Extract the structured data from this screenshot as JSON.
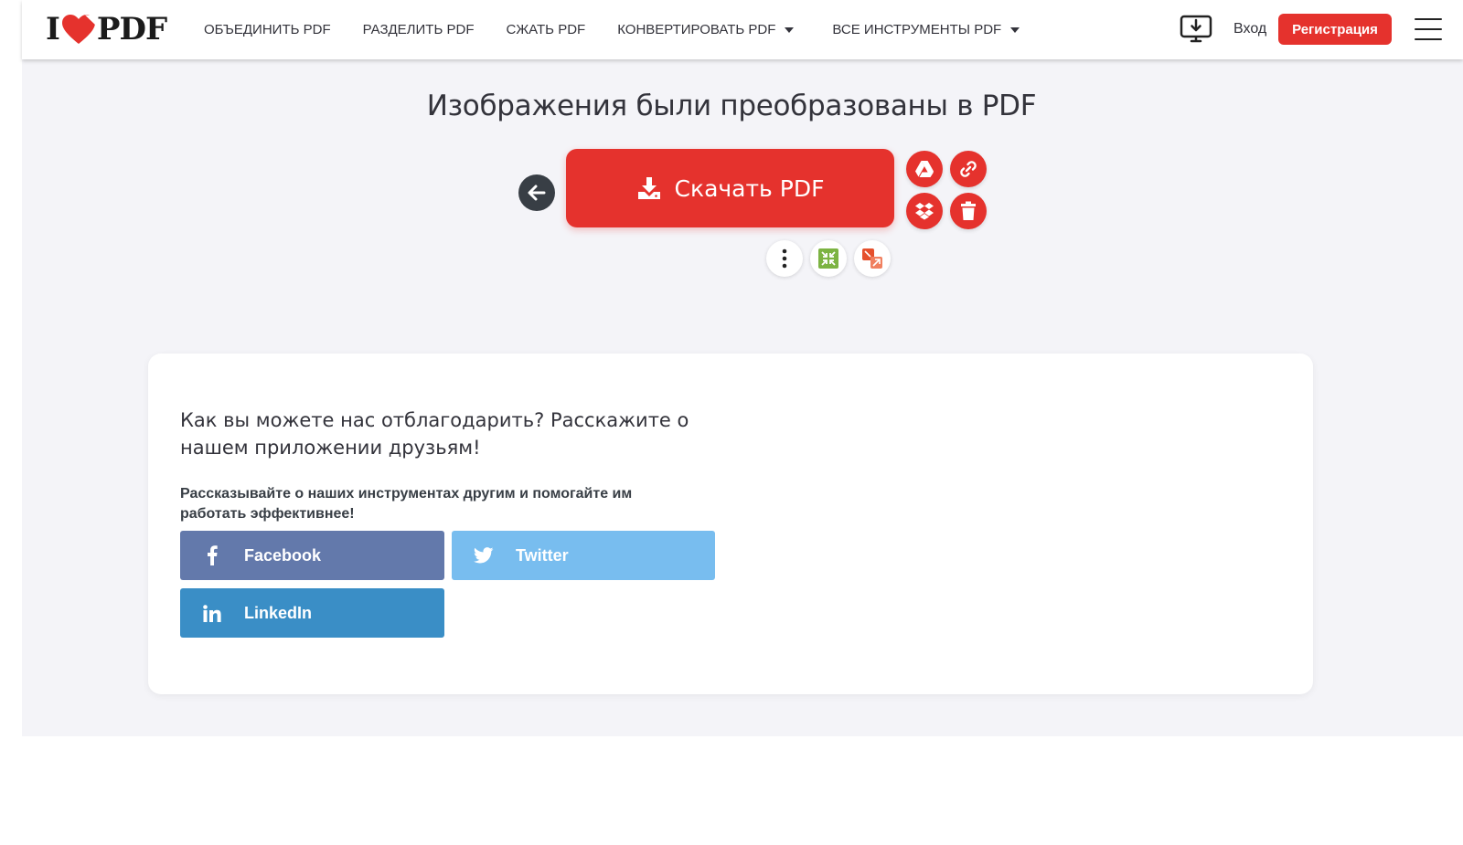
{
  "header": {
    "logo_left": "I",
    "logo_right": "PDF",
    "nav": [
      {
        "label": "ОБЪЕДИНИТЬ PDF"
      },
      {
        "label": "РАЗДЕЛИТЬ PDF"
      },
      {
        "label": "СЖАТЬ PDF"
      },
      {
        "label": "КОНВЕРТИРОВАТЬ PDF"
      },
      {
        "label": "ВСЕ ИНСТРУМЕНТЫ PDF"
      }
    ],
    "login": "Вход",
    "signup": "Регистрация"
  },
  "main": {
    "title": "Изображения были преобразованы в PDF",
    "download_label": "Скачать PDF"
  },
  "share": {
    "title": "Как вы можете нас отблагодарить? Расскажите о нашем приложении друзьям!",
    "subtitle": "Рассказывайте о наших инструментах другим и помогайте им работать эффективнее!",
    "facebook": "Facebook",
    "twitter": "Twitter",
    "linkedin": "LinkedIn"
  },
  "colors": {
    "brand_red": "#e5322d",
    "facebook": "#6379ab",
    "twitter": "#78bdef",
    "linkedin": "#3a8ec6",
    "background": "#f4f4f8"
  },
  "icons": [
    "heart-icon",
    "desktop-download-icon",
    "hamburger-icon",
    "arrow-left-icon",
    "download-icon",
    "google-drive-icon",
    "link-icon",
    "dropbox-icon",
    "trash-icon",
    "more-icon",
    "compress-icon",
    "pdf-to-image-icon",
    "facebook-icon",
    "twitter-icon",
    "linkedin-icon"
  ]
}
